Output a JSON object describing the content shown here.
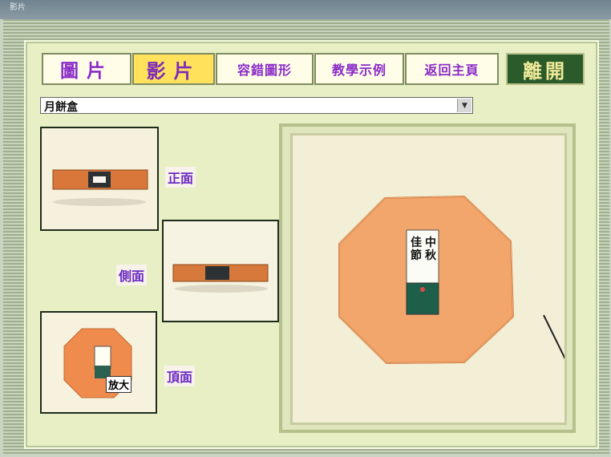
{
  "window": {
    "title": "影片"
  },
  "toolbar": {
    "tab_pictures": "圖片",
    "tab_video": "影片",
    "tab_packaging": "容錯圖形",
    "tab_examples": "教學示例",
    "tab_home": "返回主頁",
    "tab_exit": "離開"
  },
  "selector": {
    "selected": "月餅盒"
  },
  "views": {
    "front": "正面",
    "side": "側面",
    "top": "頂面"
  },
  "thumbnail_top": {
    "zoom_label": "放大"
  },
  "box_label": {
    "left": "佳節",
    "right": "中秋"
  },
  "colors": {
    "accent": "#ffe15c",
    "panel": "#e8efc4",
    "box": "#f0a060"
  }
}
